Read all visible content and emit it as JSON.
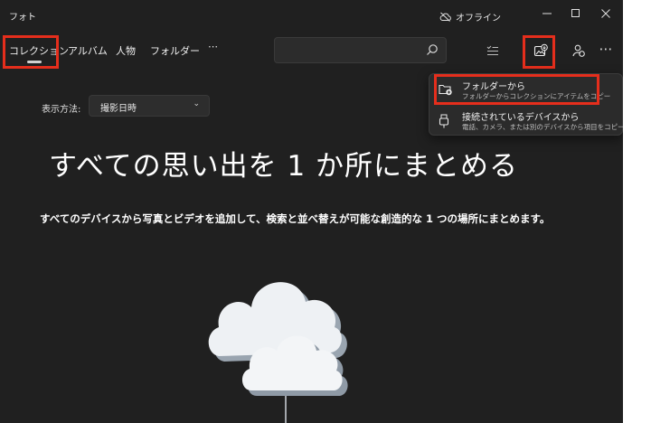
{
  "app": {
    "title": "フォト",
    "status": "オフライン"
  },
  "tabs": [
    {
      "label": "コレクション",
      "selected": true
    },
    {
      "label": "アルバム"
    },
    {
      "label": "人物"
    },
    {
      "label": "フォルダー"
    },
    {
      "label": "⋯"
    }
  ],
  "toolbar": {
    "more_label": "⋯"
  },
  "sort": {
    "label": "表示方法:",
    "value": "撮影日時"
  },
  "hero": {
    "title": "すべての思い出を 1 か所にまとめる",
    "subtitle": "すべてのデバイスから写真とビデオを追加して、検索と並べ替えが可能な創造的な 1 つの場所にまとめます。"
  },
  "import_menu": {
    "items": [
      {
        "title": "フォルダーから",
        "description": "フォルダーからコレクションにアイテムをコピー"
      },
      {
        "title": "接続されているデバイスから",
        "description": "電話、カメラ、または別のデバイスから項目をコピーする"
      }
    ]
  },
  "colors": {
    "background": "#202020",
    "highlight": "#e52e1c",
    "menu_background": "#2b2b2b"
  }
}
